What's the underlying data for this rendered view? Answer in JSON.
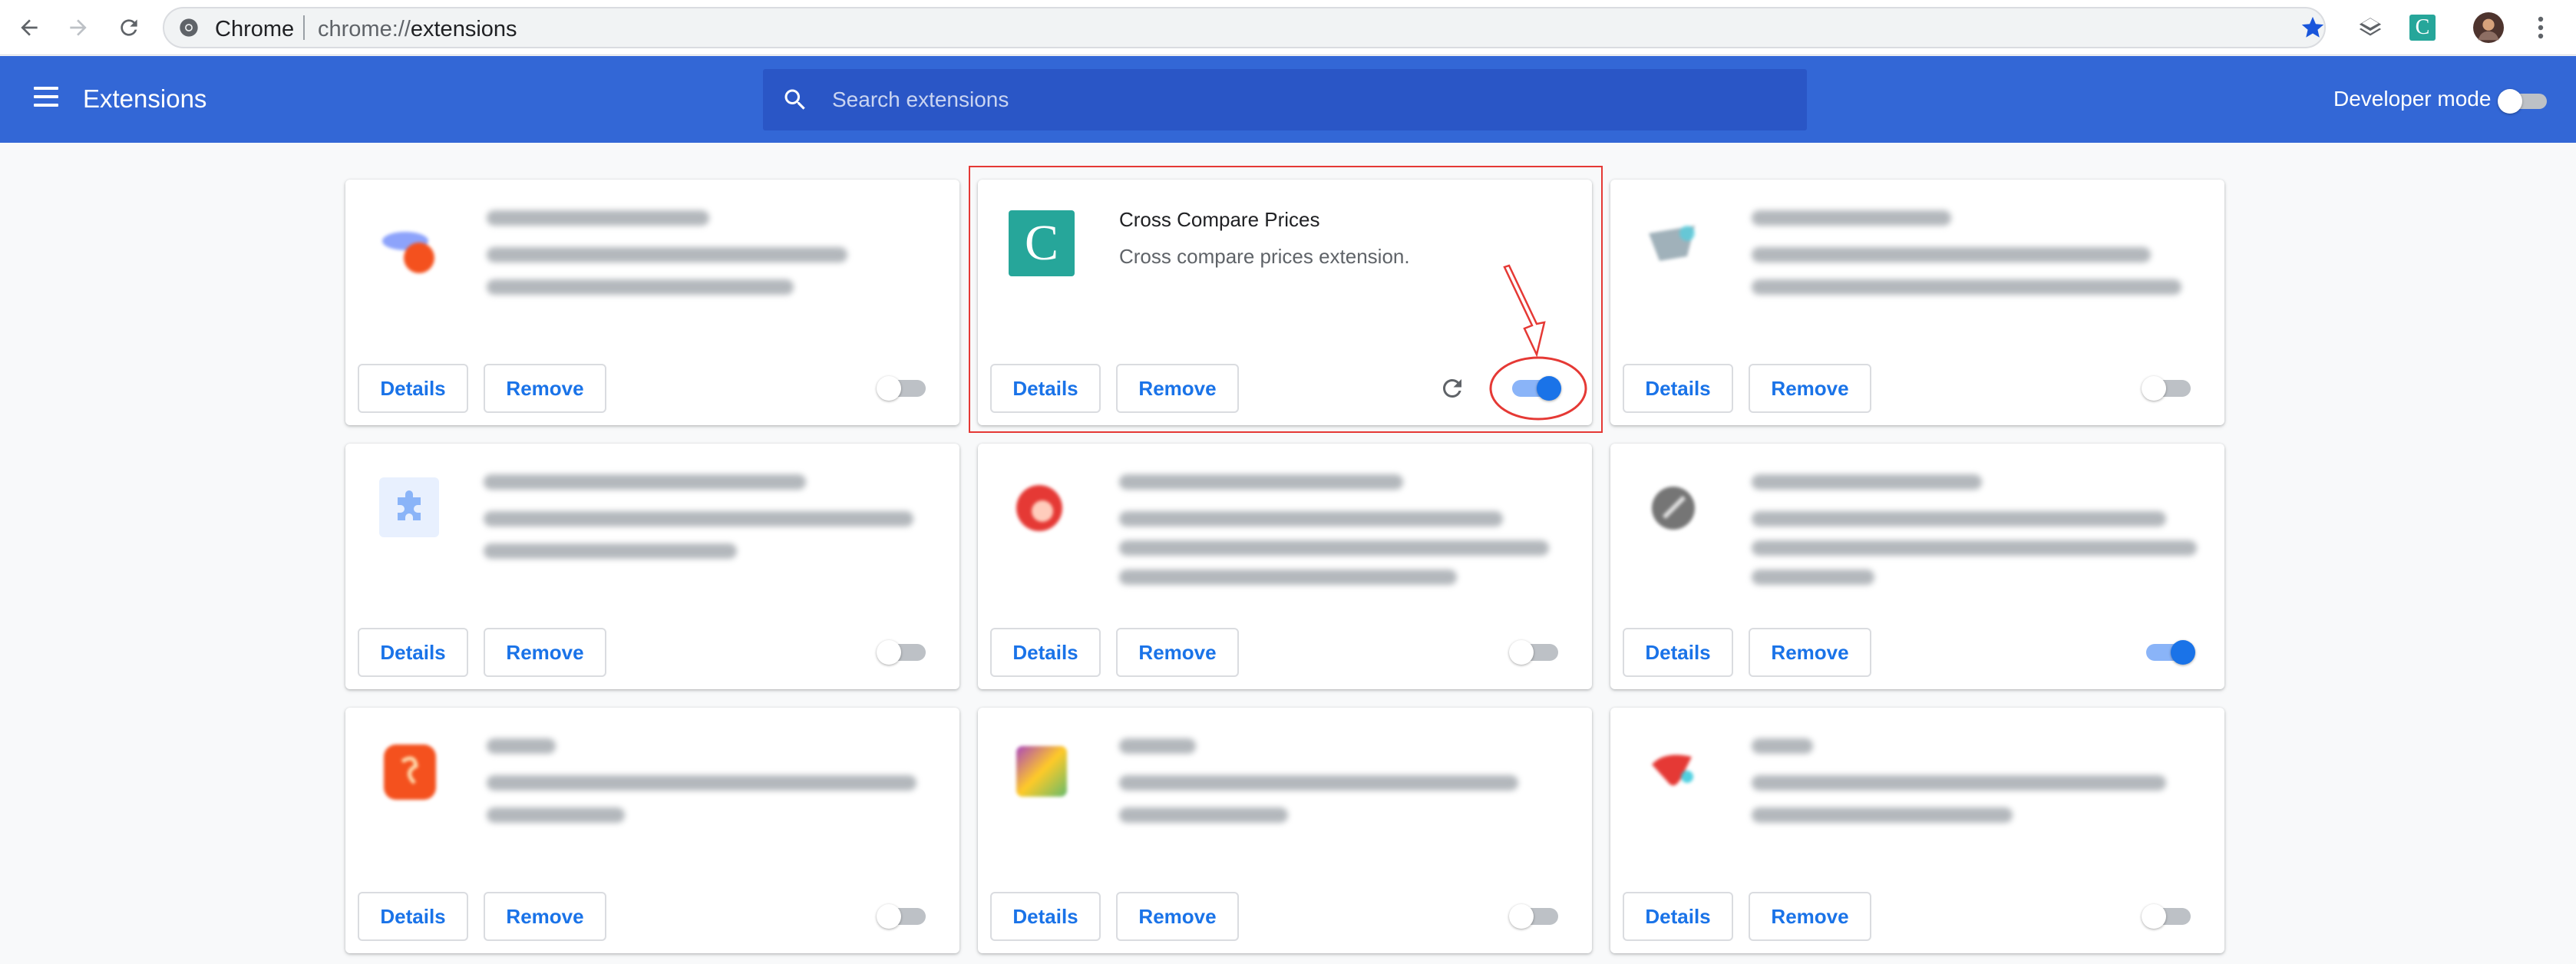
{
  "browser": {
    "site_label": "Chrome",
    "url_scheme": "chrome://",
    "url_host": "extensions",
    "extension_badge": "C"
  },
  "header": {
    "title": "Extensions",
    "search_placeholder": "Search extensions",
    "developer_mode_label": "Developer mode",
    "developer_mode_on": false
  },
  "colors": {
    "header_bg": "#3367d6",
    "search_bg": "#2a56c6",
    "accent": "#1a73e8",
    "highlight": "#e53935",
    "teal_icon": "#26a69a"
  },
  "cards": [
    {
      "name": "",
      "description": "",
      "enabled": false,
      "details_label": "Details",
      "remove_label": "Remove"
    },
    {
      "name": "Cross Compare Prices",
      "description": "Cross compare prices extension.",
      "enabled": true,
      "icon_letter": "C",
      "details_label": "Details",
      "remove_label": "Remove"
    },
    {
      "name": "",
      "description": "",
      "enabled": false,
      "details_label": "Details",
      "remove_label": "Remove"
    },
    {
      "name": "",
      "description": "",
      "enabled": false,
      "details_label": "Details",
      "remove_label": "Remove"
    },
    {
      "name": "",
      "description": "",
      "enabled": false,
      "details_label": "Details",
      "remove_label": "Remove"
    },
    {
      "name": "",
      "description": "",
      "enabled": true,
      "details_label": "Details",
      "remove_label": "Remove"
    },
    {
      "name": "",
      "description": "",
      "enabled": false,
      "details_label": "Details",
      "remove_label": "Remove"
    },
    {
      "name": "",
      "description": "",
      "enabled": false,
      "details_label": "Details",
      "remove_label": "Remove"
    },
    {
      "name": "",
      "description": "",
      "enabled": false,
      "details_label": "Details",
      "remove_label": "Remove"
    }
  ]
}
